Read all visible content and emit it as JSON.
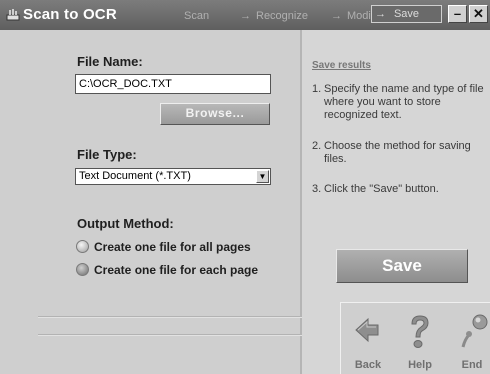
{
  "title_bar": {
    "app_title": "Scan to OCR",
    "steps": [
      "Scan",
      "Recognize",
      "Modify",
      "Save"
    ],
    "arrow": "→",
    "minimize_glyph": "–",
    "close_glyph": "✕"
  },
  "file_name": {
    "label": "File Name:",
    "value": "C:\\OCR_DOC.TXT",
    "browse_label": "Browse..."
  },
  "file_type": {
    "label": "File Type:",
    "selected": "Text Document (*.TXT)"
  },
  "output_method": {
    "label": "Output Method:",
    "options": [
      "Create one file for all pages",
      "Create one file for each page"
    ],
    "selected_index": 1
  },
  "help": {
    "title": "Save results",
    "steps": [
      {
        "num": "1.",
        "text": "Specify the name and type of file where you want to store recognized text."
      },
      {
        "num": "2.",
        "text": "Choose the method for saving files."
      },
      {
        "num": "3.",
        "text": "Click the \"Save\" button."
      }
    ]
  },
  "save_button": "Save",
  "nav": {
    "back": "Back",
    "help": "Help",
    "end": "End"
  },
  "icons": {
    "app": "scanner-icon",
    "back": "left-arrow-icon",
    "help": "question-mark-icon",
    "end": "exit-icon"
  }
}
